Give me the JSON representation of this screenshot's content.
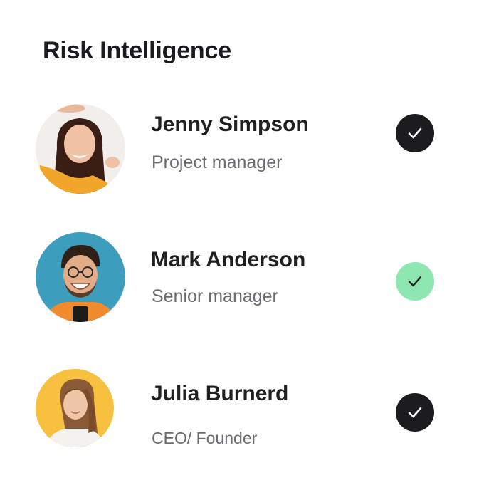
{
  "title": "Risk Intelligence",
  "members": [
    {
      "name": "Jenny Simpson",
      "role": "Project manager",
      "status": "approved",
      "check_color": "#1c1c1f",
      "avatar_bg": "#f2eeec"
    },
    {
      "name": "Mark Anderson",
      "role": "Senior manager",
      "status": "approved",
      "check_color": "#8ee7b0",
      "avatar_bg": "#3d9dbd"
    },
    {
      "name": "Julia Burnerd",
      "role": "CEO/ Founder",
      "status": "approved",
      "check_color": "#1c1c1f",
      "avatar_bg": "#f7c13f"
    }
  ],
  "icons": {
    "check": "check-icon"
  }
}
